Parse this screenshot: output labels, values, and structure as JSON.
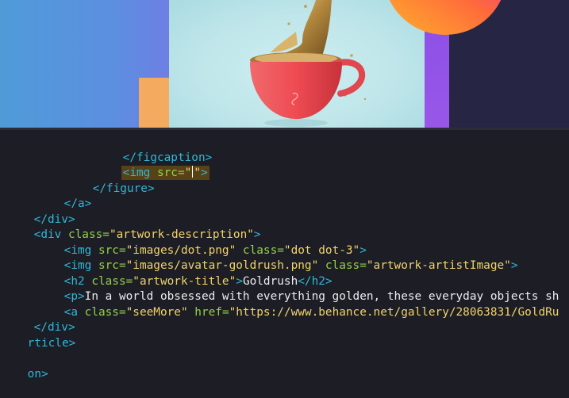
{
  "preview": {
    "colors": {
      "blue_left": "#5c8fe0",
      "orange": "#f4ab60",
      "purple": "#9957e8",
      "dark_navy": "#272544",
      "mint_background": "#bfe6ea",
      "cup_red": "#ee4b52",
      "gold": "#b58a3f"
    }
  },
  "editor": {
    "colors": {
      "background": "#1c1d25",
      "tag": "#2fb8d6",
      "attribute": "#96d04a",
      "string": "#f1d36a",
      "text": "#ededed",
      "selection": "#574217"
    },
    "lines": [
      {
        "tag": "</figcaption>"
      },
      {
        "tag_open": "<img ",
        "attr": "src=",
        "str": "\"\"",
        "tag_close": ">"
      },
      {
        "tag": "</figure>"
      },
      {
        "tag": "</a>"
      },
      {
        "tag": "</div>"
      },
      {
        "tag_open": "<div ",
        "attr": "class=",
        "str": "\"artwork-description\"",
        "tag_close": ">"
      },
      {
        "tag_open": "<img ",
        "attr1": "src=",
        "str1": "\"images/dot.png\"",
        "attr2": " class=",
        "str2": "\"dot dot-3\"",
        "tag_close": ">"
      },
      {
        "tag_open": "<img ",
        "attr1": "src=",
        "str1": "\"images/avatar-goldrush.png\"",
        "attr2": " class=",
        "str2": "\"artwork-artistImage\"",
        "tag_close": ">"
      },
      {
        "tag_open": "<h2 ",
        "attr": "class=",
        "str": "\"artwork-title\"",
        "tag_mid": ">",
        "text": "Goldrush",
        "tag_close": "</h2>"
      },
      {
        "tag_open": "<p>",
        "text": "In a world obsessed with everything golden, these everyday objects sh"
      },
      {
        "tag_open": "<a ",
        "attr1": "class=",
        "str1": "\"seeMore\"",
        "attr2": " href=",
        "str2": "\"https://www.behance.net/gallery/28063831/GoldRu"
      },
      {
        "tag": "</div>"
      },
      {
        "tag": "rticle>"
      },
      {
        "tag": "on>"
      }
    ]
  }
}
